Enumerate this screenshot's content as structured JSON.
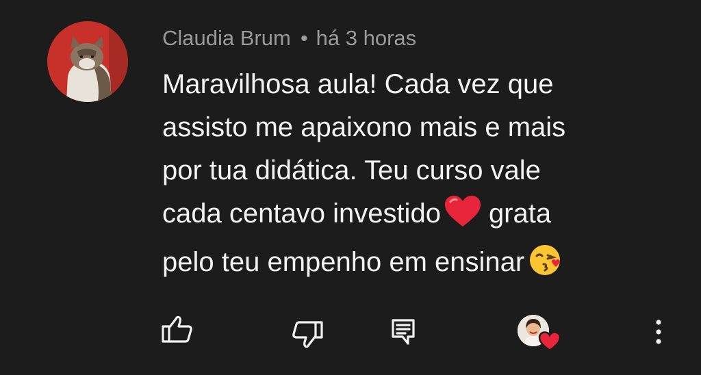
{
  "comment": {
    "author": "Claudia Brum",
    "separator": "•",
    "timestamp": "há 3 horas",
    "lines": [
      "Maravilhosa aula! Cada vez que",
      "assisto me apaixono mais e mais",
      "por tua didática. Teu curso vale",
      "cada centavo investido",
      "grata",
      "pelo teu empenho em ensinar"
    ]
  },
  "icons": {
    "avatar": "cat-photo-avatar",
    "inline_heart": "red-heart-emoji",
    "inline_kiss": "face-blowing-kiss-emoji",
    "like": "thumbs-up-icon",
    "dislike": "thumbs-down-icon",
    "reply": "reply-comment-icon",
    "creator_heart": "creator-heart-badge",
    "more": "more-vertical-icon"
  },
  "colors": {
    "background": "#1c1c1c",
    "text": "#f2f2f2",
    "meta_text": "#9a9a9a",
    "heart_red": "#e8253b"
  }
}
